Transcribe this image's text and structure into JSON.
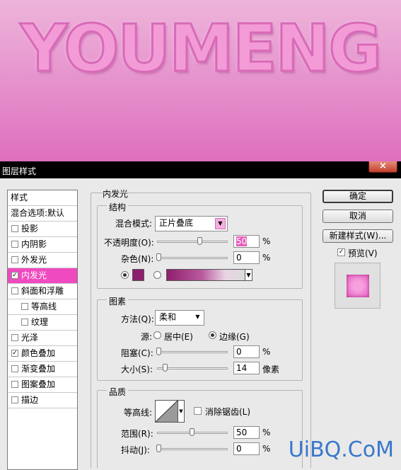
{
  "canvas": {
    "text": "YOUMENG"
  },
  "window": {
    "title": "图层样式",
    "close": "×"
  },
  "styles": {
    "header": "样式",
    "blend_options": "混合选项:默认",
    "items": [
      {
        "label": "投影",
        "checked": false,
        "indent": false
      },
      {
        "label": "内阴影",
        "checked": false,
        "indent": false
      },
      {
        "label": "外发光",
        "checked": false,
        "indent": false
      },
      {
        "label": "内发光",
        "checked": true,
        "indent": false,
        "selected": true
      },
      {
        "label": "斜面和浮雕",
        "checked": false,
        "indent": false
      },
      {
        "label": "等高线",
        "checked": false,
        "indent": true
      },
      {
        "label": "纹理",
        "checked": false,
        "indent": true
      },
      {
        "label": "光泽",
        "checked": false,
        "indent": false
      },
      {
        "label": "颜色叠加",
        "checked": true,
        "indent": false
      },
      {
        "label": "渐变叠加",
        "checked": false,
        "indent": false
      },
      {
        "label": "图案叠加",
        "checked": false,
        "indent": false
      },
      {
        "label": "描边",
        "checked": false,
        "indent": false
      }
    ]
  },
  "inner_glow": {
    "title": "内发光",
    "structure": {
      "title": "结构",
      "blend_mode_label": "混合模式:",
      "blend_mode_value": "正片叠底",
      "opacity_label": "不透明度(O):",
      "opacity_value": "50",
      "opacity_unit": "%",
      "noise_label": "杂色(N):",
      "noise_value": "0",
      "noise_unit": "%",
      "glow_color": "#8e1f6c"
    },
    "elements": {
      "title": "图素",
      "method_label": "方法(Q):",
      "method_value": "柔和",
      "source_label": "源:",
      "source_center": "居中(E)",
      "source_edge": "边缘(G)",
      "choke_label": "阻塞(C):",
      "choke_value": "0",
      "choke_unit": "%",
      "size_label": "大小(S):",
      "size_value": "14",
      "size_unit": "像素"
    },
    "quality": {
      "title": "品质",
      "contour_label": "等高线:",
      "antialias_label": "消除锯齿(L)",
      "range_label": "范围(R):",
      "range_value": "50",
      "range_unit": "%",
      "jitter_label": "抖动(J):",
      "jitter_value": "0",
      "jitter_unit": "%"
    }
  },
  "buttons": {
    "ok": "确定",
    "cancel": "取消",
    "new_style": "新建样式(W)...",
    "preview_label": "预览(V)"
  },
  "watermark": "UiBQ.CoM"
}
